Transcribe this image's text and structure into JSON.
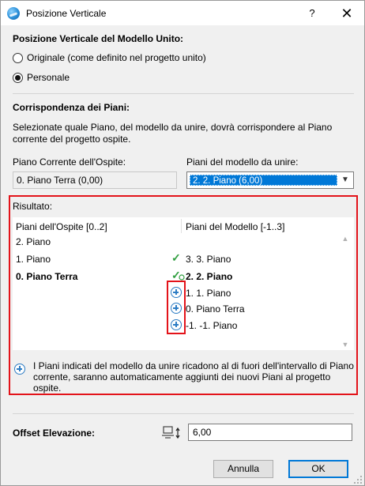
{
  "window": {
    "title": "Posizione Verticale",
    "help_glyph": "?",
    "close_glyph": "✕"
  },
  "vertical_position": {
    "heading": "Posizione Verticale del Modello Unito:",
    "option_original": "Originale (come definito nel progetto unito)",
    "option_custom": "Personale",
    "selected": "Personale"
  },
  "floor_match": {
    "heading": "Corrispondenza dei Piani:",
    "description_line1": "Selezionate quale Piano, del modello da unire, dovrà corrispondere al Piano",
    "description_line2": "corrente del progetto ospite.",
    "host_label": "Piano Corrente dell'Ospite:",
    "host_value": "0. Piano Terra (0,00)",
    "model_label": "Piani del modello da unire:",
    "model_value": "2. 2. Piano (6,00)"
  },
  "result": {
    "heading": "Risultato:",
    "col_host": "Piani dell'Ospite [0..2]",
    "col_model": "Piani del Modello [-1..3]",
    "rows": [
      {
        "host": "2. Piano",
        "model": "",
        "marker": ""
      },
      {
        "host": "1. Piano",
        "model": "3. 3. Piano",
        "marker": "check"
      },
      {
        "host": "0. Piano Terra",
        "model": "2. 2. Piano",
        "marker": "check-current"
      },
      {
        "host": "",
        "model": "1. 1. Piano",
        "marker": "plus"
      },
      {
        "host": "",
        "model": "0. Piano Terra",
        "marker": "plus"
      },
      {
        "host": "",
        "model": "-1. -1. Piano",
        "marker": "plus"
      }
    ],
    "note_line1": "I Piani indicati del modello da unire ricadono al di fuori dell'intervallo di Piano",
    "note_line2": "corrente, saranno automaticamente aggiunti dei nuovi Piani al progetto",
    "note_line3": "ospite."
  },
  "offset": {
    "label": "Offset Elevazione:",
    "value": "6,00"
  },
  "buttons": {
    "cancel": "Annulla",
    "ok": "OK"
  },
  "colors": {
    "highlight": "#e3131a",
    "selection": "#0078d7",
    "check": "#2f9e3f",
    "plus": "#2c7cc4"
  }
}
